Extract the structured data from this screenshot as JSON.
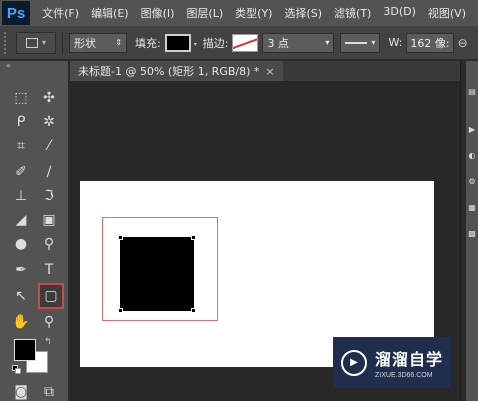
{
  "app": {
    "logo": "Ps"
  },
  "menu": {
    "items": [
      "文件(F)",
      "编辑(E)",
      "图像(I)",
      "图层(L)",
      "类型(Y)",
      "选择(S)",
      "滤镜(T)",
      "3D(D)",
      "视图(V)"
    ]
  },
  "options_bar": {
    "mode_select": "形状",
    "fill_label": "填充:",
    "fill_color": "#000000",
    "stroke_label": "描边:",
    "stroke_width": "3 点",
    "width_label": "W:",
    "width_value": "162 像:"
  },
  "document": {
    "tab_title": "未标题-1 @ 50% (矩形 1, RGB/8) *",
    "close_glyph": "×",
    "canvas_color": "#ffffff",
    "shape_color": "#000000",
    "bbox_color": "#e07070"
  },
  "colors": {
    "foreground": "#000000",
    "background": "#ffffff"
  },
  "watermark": {
    "title": "溜溜自学",
    "url": "ZIXUE.3D66.COM"
  }
}
